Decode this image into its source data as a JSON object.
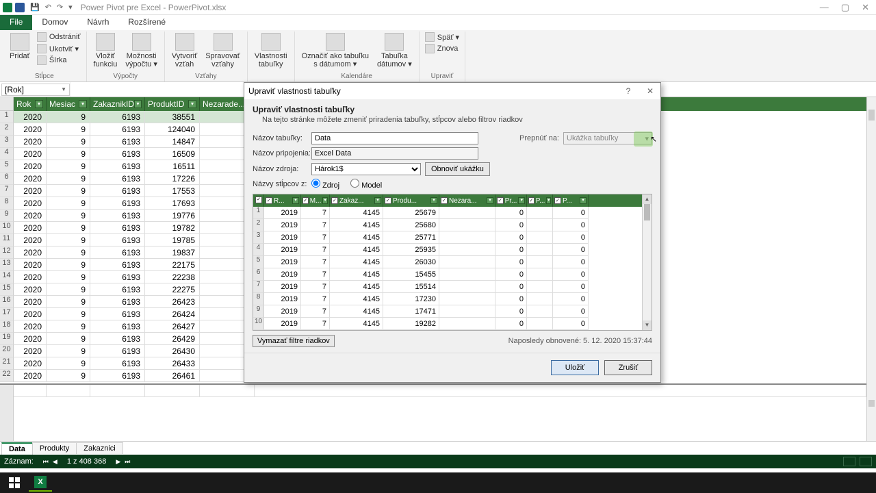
{
  "title": "Power Pivot pre Excel - PowerPivot.xlsx",
  "ribbon_tabs": {
    "file": "File",
    "domov": "Domov",
    "navrh": "Návrh",
    "rozsirene": "Rozšírené"
  },
  "ribbon": {
    "g1": {
      "pridat": "Pridať",
      "odstranit": "Odstrániť",
      "ukotvit": "Ukotviť ▾",
      "sirka": "Šírka",
      "label": "Stĺpce"
    },
    "g2": {
      "vlozit_fn": "Vložiť\nfunkciu",
      "moznosti": "Možnosti\nvýpočtu ▾",
      "label": "Výpočty"
    },
    "g3": {
      "vytvorit": "Vytvoriť\nvzťah",
      "spravovat": "Spravovať\nvzťahy",
      "label": "Vzťahy"
    },
    "g4": {
      "vlast": "Vlastnosti\ntabuľky",
      "label": ""
    },
    "g5": {
      "oznac": "Označiť ako tabuľku\ns dátumom ▾",
      "tab": "Tabuľka\ndátumov ▾",
      "label": "Kalendáre"
    },
    "g6": {
      "spat": "Späť ▾",
      "znova": "Znova",
      "label": "Upraviť"
    }
  },
  "namebox": "[Rok]",
  "bg_cols": {
    "rok": "Rok",
    "mesiac": "Mesiac",
    "zakaznik": "ZakaznikID",
    "produkt": "ProduktID",
    "nezar": "Nezarade..."
  },
  "bg_rows": [
    [
      "2020",
      "9",
      "6193",
      "38551"
    ],
    [
      "2020",
      "9",
      "6193",
      "124040"
    ],
    [
      "2020",
      "9",
      "6193",
      "14847"
    ],
    [
      "2020",
      "9",
      "6193",
      "16509"
    ],
    [
      "2020",
      "9",
      "6193",
      "16511"
    ],
    [
      "2020",
      "9",
      "6193",
      "17226"
    ],
    [
      "2020",
      "9",
      "6193",
      "17553"
    ],
    [
      "2020",
      "9",
      "6193",
      "17693"
    ],
    [
      "2020",
      "9",
      "6193",
      "19776"
    ],
    [
      "2020",
      "9",
      "6193",
      "19782"
    ],
    [
      "2020",
      "9",
      "6193",
      "19785"
    ],
    [
      "2020",
      "9",
      "6193",
      "19837"
    ],
    [
      "2020",
      "9",
      "6193",
      "22175"
    ],
    [
      "2020",
      "9",
      "6193",
      "22238"
    ],
    [
      "2020",
      "9",
      "6193",
      "22275"
    ],
    [
      "2020",
      "9",
      "6193",
      "26423"
    ],
    [
      "2020",
      "9",
      "6193",
      "26424"
    ],
    [
      "2020",
      "9",
      "6193",
      "26427"
    ],
    [
      "2020",
      "9",
      "6193",
      "26429"
    ],
    [
      "2020",
      "9",
      "6193",
      "26430"
    ],
    [
      "2020",
      "9",
      "6193",
      "26433"
    ],
    [
      "2020",
      "9",
      "6193",
      "26461"
    ]
  ],
  "sheet_tabs": {
    "data": "Data",
    "produkty": "Produkty",
    "zakaznici": "Zakaznici"
  },
  "status": {
    "zaznam": "Záznam:",
    "count": "1 z 408 368"
  },
  "dialog": {
    "title": "Upraviť vlastnosti tabuľky",
    "heading": "Upraviť vlastnosti tabuľky",
    "sub": "Na tejto stránke môžete zmeniť priradenia tabuľky, stĺpcov alebo filtrov riadkov",
    "lbl_table": "Názov tabuľky:",
    "val_table": "Data",
    "lbl_conn": "Názov pripojenia:",
    "val_conn": "Excel Data",
    "lbl_src": "Názov zdroja:",
    "val_src": "Hárok1$",
    "btn_refresh": "Obnoviť ukážku",
    "lbl_colnames": "Názvy stĺpcov z:",
    "radio_zdroj": "Zdroj",
    "radio_model": "Model",
    "lbl_prep": "Prepnúť na:",
    "val_prep": "Ukážka tabuľky",
    "pcols": [
      "R...",
      "M...",
      "Zakaz...",
      "Produ...",
      "Nezara...",
      "Pr...",
      "P...",
      "P..."
    ],
    "prows": [
      [
        "2019",
        "7",
        "4145",
        "25679",
        "",
        "0",
        "",
        "0"
      ],
      [
        "2019",
        "7",
        "4145",
        "25680",
        "",
        "0",
        "",
        "0"
      ],
      [
        "2019",
        "7",
        "4145",
        "25771",
        "",
        "0",
        "",
        "0"
      ],
      [
        "2019",
        "7",
        "4145",
        "25935",
        "",
        "0",
        "",
        "0"
      ],
      [
        "2019",
        "7",
        "4145",
        "26030",
        "",
        "0",
        "",
        "0"
      ],
      [
        "2019",
        "7",
        "4145",
        "15455",
        "",
        "0",
        "",
        "0"
      ],
      [
        "2019",
        "7",
        "4145",
        "15514",
        "",
        "0",
        "",
        "0"
      ],
      [
        "2019",
        "7",
        "4145",
        "17230",
        "",
        "0",
        "",
        "0"
      ],
      [
        "2019",
        "7",
        "4145",
        "17471",
        "",
        "0",
        "",
        "0"
      ],
      [
        "2019",
        "7",
        "4145",
        "19282",
        "",
        "0",
        "",
        "0"
      ]
    ],
    "btn_clear": "Vymazať filtre riadkov",
    "last_refresh": "Naposledy obnovené: 5. 12. 2020 15:37:44",
    "btn_save": "Uložiť",
    "btn_cancel": "Zrušiť"
  }
}
